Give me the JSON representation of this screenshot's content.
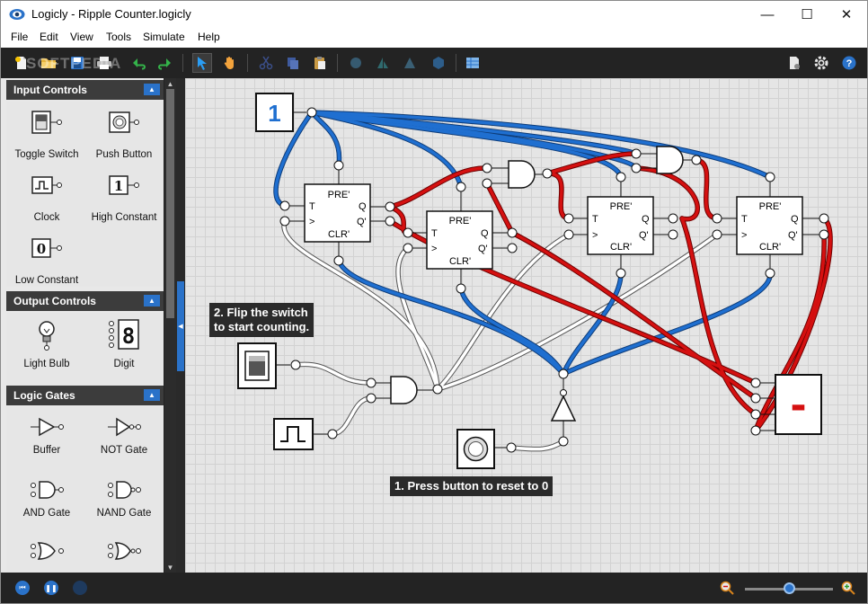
{
  "window": {
    "title": "Logicly - Ripple Counter.logicly",
    "controls": {
      "minimize": "—",
      "maximize": "☐",
      "close": "✕"
    }
  },
  "menu": [
    "File",
    "Edit",
    "View",
    "Tools",
    "Simulate",
    "Help"
  ],
  "watermark": "SOFTPEDIA",
  "sidebar": {
    "sections": [
      {
        "title": "Input Controls",
        "items": [
          {
            "label": "Toggle Switch",
            "icon": "toggle-switch-icon"
          },
          {
            "label": "Push Button",
            "icon": "push-button-icon"
          },
          {
            "label": "Clock",
            "icon": "clock-icon"
          },
          {
            "label": "High Constant",
            "icon": "high-constant-icon",
            "glyph": "1"
          },
          {
            "label": "Low Constant",
            "icon": "low-constant-icon",
            "glyph": "0"
          }
        ]
      },
      {
        "title": "Output Controls",
        "items": [
          {
            "label": "Light Bulb",
            "icon": "light-bulb-icon"
          },
          {
            "label": "Digit",
            "icon": "digit-icon",
            "glyph": "8"
          }
        ]
      },
      {
        "title": "Logic Gates",
        "items": [
          {
            "label": "Buffer",
            "icon": "buffer-gate-icon"
          },
          {
            "label": "NOT Gate",
            "icon": "not-gate-icon"
          },
          {
            "label": "AND Gate",
            "icon": "and-gate-icon"
          },
          {
            "label": "NAND Gate",
            "icon": "nand-gate-icon"
          }
        ]
      }
    ]
  },
  "circuit": {
    "high_constant_value": "1",
    "flipflops": [
      {
        "pre": "PRE'",
        "t": "T",
        "clk": ">",
        "clr": "CLR'",
        "q": "Q",
        "qn": "Q'"
      },
      {
        "pre": "PRE'",
        "t": "T",
        "clk": ">",
        "clr": "CLR'",
        "q": "Q",
        "qn": "Q'"
      },
      {
        "pre": "PRE'",
        "t": "T",
        "clk": ">",
        "clr": "CLR'",
        "q": "Q",
        "qn": "Q'"
      },
      {
        "pre": "PRE'",
        "t": "T",
        "clk": ">",
        "clr": "CLR'",
        "q": "Q",
        "qn": "Q'"
      }
    ],
    "digit_display": "-",
    "callout_switch": [
      "2. Flip the switch",
      "to start counting."
    ],
    "callout_button": "1. Press button to reset to 0",
    "wire_colors": {
      "high": "#1f6fd0",
      "active": "#d51010",
      "low": "#ffffff"
    }
  },
  "status": {
    "zoom_value": 0.5
  },
  "colors": {
    "accent": "#2a72c9",
    "toolbar_bg": "#232323"
  }
}
